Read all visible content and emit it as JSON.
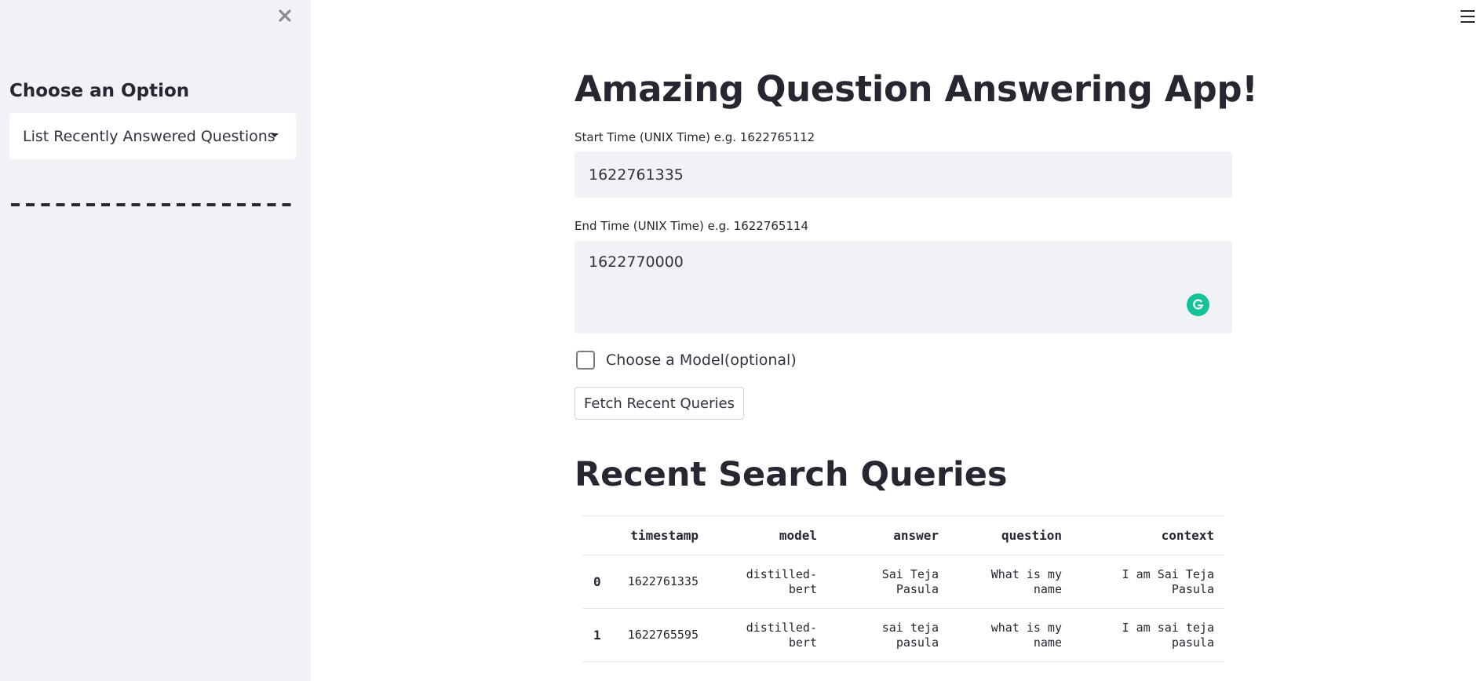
{
  "sidebar": {
    "heading": "Choose an Option",
    "select_value": "List Recently Answered Questions",
    "close_icon": "close-icon",
    "background": "#f0f2f6"
  },
  "header": {
    "menu_icon": "hamburger-menu-icon"
  },
  "main": {
    "title": "Amazing Question Answering App!",
    "start_label": "Start Time (UNIX Time) e.g. 1622765112",
    "start_value": "1622761335",
    "end_label": "End Time (UNIX Time) e.g. 1622765114",
    "end_value": "1622770000",
    "model_checkbox_label": "Choose a Model(optional)",
    "model_checkbox_checked": false,
    "fetch_button": "Fetch Recent Queries",
    "section_title": "Recent Search Queries",
    "grammarly_icon": "grammarly-icon",
    "grammarly_color": "#15c39a"
  },
  "table": {
    "columns": [
      "",
      "timestamp",
      "model",
      "answer",
      "question",
      "context"
    ],
    "rows": [
      {
        "index": "0",
        "timestamp": "1622761335",
        "model": "distilled-\nbert",
        "answer": "Sai Teja\nPasula",
        "question": "What is my\nname",
        "context": "I am Sai Teja\nPasula"
      },
      {
        "index": "1",
        "timestamp": "1622765595",
        "model": "distilled-\nbert",
        "answer": "sai teja\npasula",
        "question": "what is my\nname",
        "context": "I am sai teja\npasula"
      }
    ]
  }
}
